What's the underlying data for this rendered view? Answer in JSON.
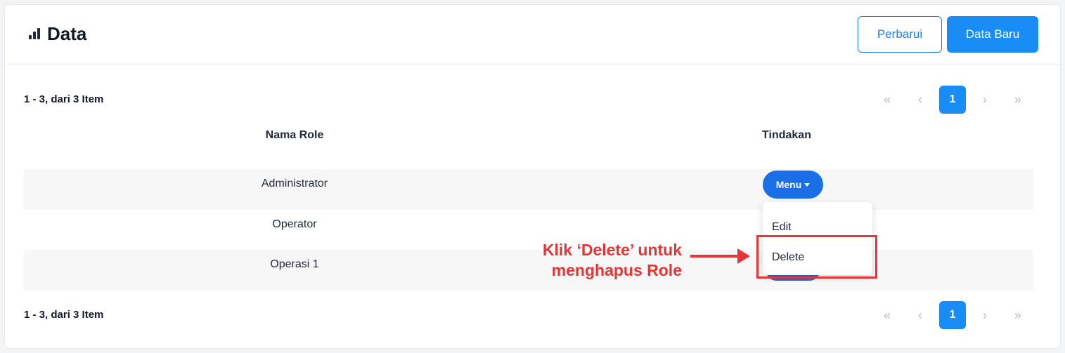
{
  "header": {
    "title": "Data",
    "icon": "bar-chart-icon",
    "refresh_label": "Perbarui",
    "new_label": "Data Baru"
  },
  "summary": {
    "top": "1 - 3, dari 3 Item",
    "bottom": "1 - 3, dari 3 Item"
  },
  "pagination": {
    "first": "«",
    "prev": "‹",
    "current": "1",
    "next": "›",
    "last": "»"
  },
  "table": {
    "columns": [
      "Nama Role",
      "Tindakan"
    ],
    "rows": [
      {
        "role": "Administrator"
      },
      {
        "role": "Operator"
      },
      {
        "role": "Operasi 1"
      }
    ]
  },
  "actions": {
    "menu_label": "Menu",
    "dropdown": [
      "Edit",
      "Delete"
    ]
  },
  "annotation": {
    "line1": "Klik ‘Delete’ untuk",
    "line2": "menghapus Role",
    "color": "#e63535"
  },
  "colors": {
    "primary": "#1a8cf5",
    "menu": "#1a6ee6"
  }
}
